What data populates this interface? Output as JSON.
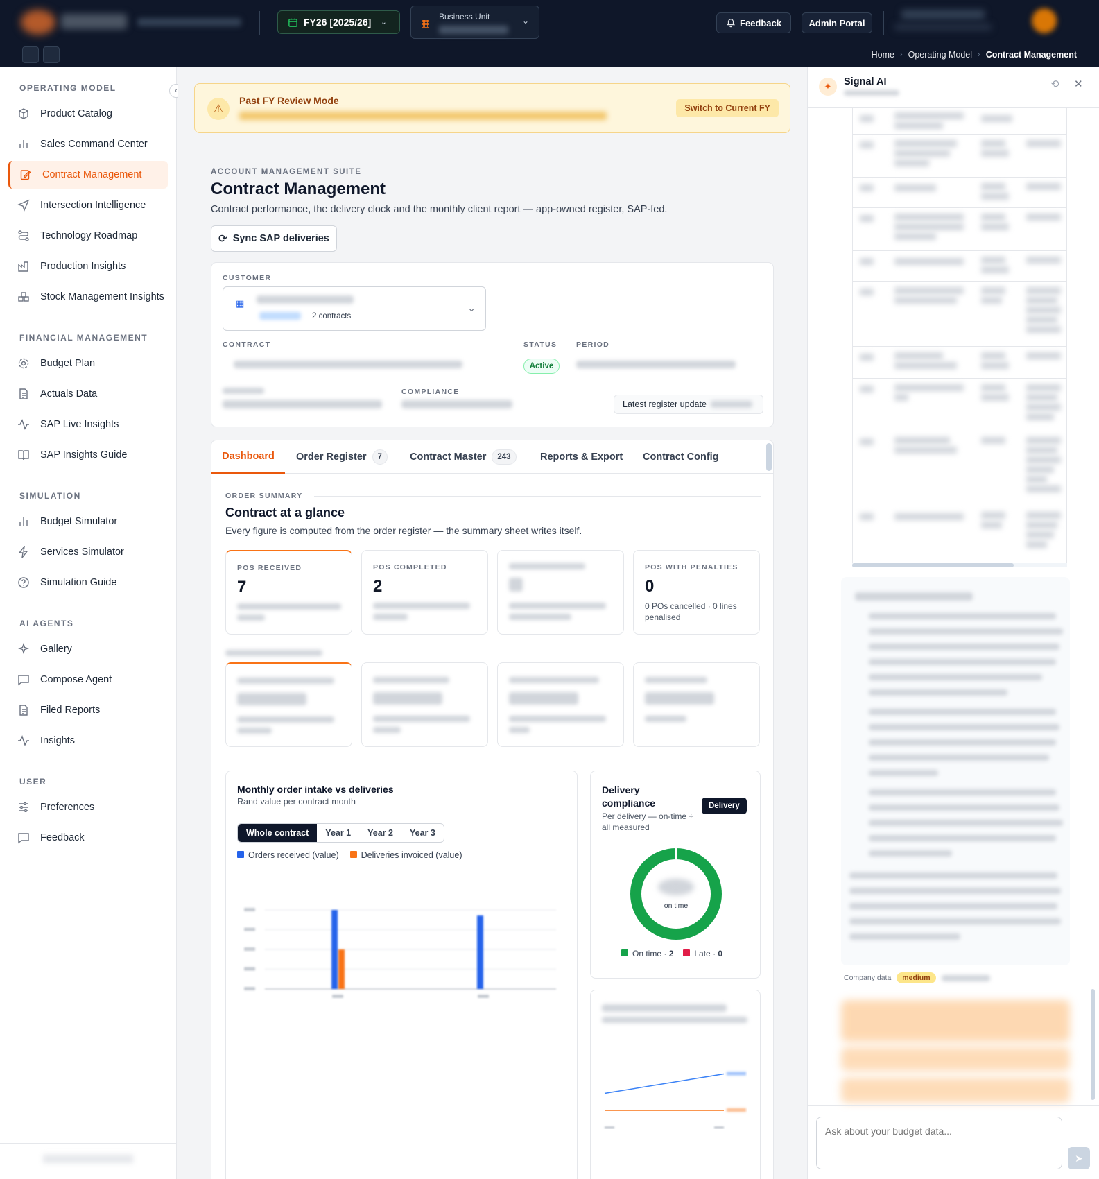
{
  "topbar": {
    "fy_label": "FY26 [2025/26]",
    "business_unit_label": "Business Unit",
    "feedback_label": "Feedback",
    "admin_label": "Admin Portal",
    "breadcrumb": [
      "Home",
      "Operating Model",
      "Contract Management"
    ]
  },
  "sidebar": {
    "sections": [
      {
        "title": "OPERATING MODEL",
        "items": [
          "Product Catalog",
          "Sales Command Center",
          "Contract Management",
          "Intersection Intelligence",
          "Technology Roadmap",
          "Production Insights",
          "Stock Management Insights"
        ]
      },
      {
        "title": "FINANCIAL MANAGEMENT",
        "items": [
          "Budget Plan",
          "Actuals Data",
          "SAP Live Insights",
          "SAP Insights Guide"
        ]
      },
      {
        "title": "SIMULATION",
        "items": [
          "Budget Simulator",
          "Services Simulator",
          "Simulation Guide"
        ]
      },
      {
        "title": "AI AGENTS",
        "items": [
          "Gallery",
          "Compose Agent",
          "Filed Reports",
          "Insights"
        ]
      },
      {
        "title": "USER",
        "items": [
          "Preferences",
          "Feedback"
        ]
      }
    ]
  },
  "banner": {
    "title": "Past FY Review Mode",
    "switch_label": "Switch to Current FY"
  },
  "page": {
    "eyebrow": "ACCOUNT MANAGEMENT SUITE",
    "title": "Contract Management",
    "description": "Contract performance, the delivery clock and the monthly client report — app-owned register, SAP-fed.",
    "sync_label": "Sync SAP deliveries"
  },
  "contract_card": {
    "customer_label": "CUSTOMER",
    "contracts_count": "2 contracts",
    "contract_label": "CONTRACT",
    "status_label": "STATUS",
    "status_value": "Active",
    "period_label": "PERIOD",
    "compliance_label": "COMPLIANCE",
    "latest_update_label": "Latest register update"
  },
  "tabs": [
    {
      "label": "Dashboard",
      "count": ""
    },
    {
      "label": "Order Register",
      "count": "7"
    },
    {
      "label": "Contract Master",
      "count": "243"
    },
    {
      "label": "Reports & Export",
      "count": ""
    },
    {
      "label": "Contract Config",
      "count": ""
    }
  ],
  "summary": {
    "eyebrow": "ORDER SUMMARY",
    "title": "Contract at a glance",
    "subtitle": "Every figure is computed from the order register — the summary sheet writes itself.",
    "kpis": [
      {
        "label": "POS RECEIVED",
        "value": "7"
      },
      {
        "label": "POS COMPLETED",
        "value": "2"
      },
      {
        "label": "POS WITH PENALTIES",
        "value": "0",
        "note": "0 POs cancelled · 0 lines penalised"
      }
    ]
  },
  "monthly_chart": {
    "title": "Monthly order intake vs deliveries",
    "subtitle": "Rand value per contract month",
    "toggles": [
      "Whole contract",
      "Year 1",
      "Year 2",
      "Year 3"
    ],
    "active_toggle": "Whole contract",
    "legend": [
      "Orders received (value)",
      "Deliveries invoiced (value)"
    ],
    "colors": {
      "orders": "#2563eb",
      "deliveries": "#f97316"
    }
  },
  "compliance_chart": {
    "title": "Delivery compliance",
    "subtitle": "Per delivery — on-time ÷ all measured",
    "toggle_label": "Delivery",
    "center_label": "on time",
    "legend": [
      {
        "label": "On time",
        "value": "2",
        "color": "#16a34a"
      },
      {
        "label": "Late",
        "value": "0",
        "color": "#e11d48"
      }
    ]
  },
  "chart_data": [
    {
      "type": "bar",
      "title": "Monthly order intake vs deliveries",
      "categories": [
        "M1",
        "M2"
      ],
      "series": [
        {
          "name": "Orders received (value)",
          "values": [
            1.0,
            0.93
          ]
        },
        {
          "name": "Deliveries invoiced (value)",
          "values": [
            0.5,
            0
          ]
        }
      ],
      "ylim": [
        0,
        1
      ]
    },
    {
      "type": "pie",
      "title": "Delivery compliance",
      "categories": [
        "On time",
        "Late"
      ],
      "values": [
        2,
        0
      ]
    },
    {
      "type": "line",
      "series": [
        {
          "values": [
            0.45,
            0.85
          ]
        },
        {
          "values": [
            0.1,
            0.1
          ]
        }
      ],
      "ylim": [
        0,
        1
      ]
    }
  ],
  "ai": {
    "title": "Signal AI",
    "source_label": "Company data",
    "confidence": "medium",
    "input_placeholder": "Ask about your budget data..."
  }
}
